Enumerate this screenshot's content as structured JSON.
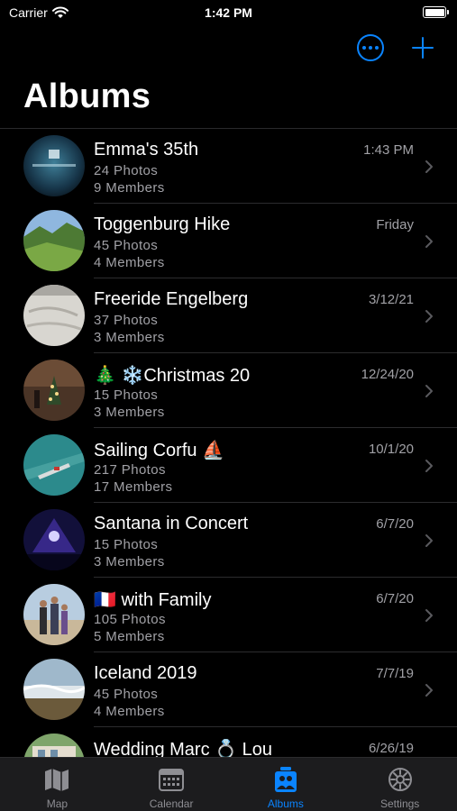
{
  "status_bar": {
    "carrier": "Carrier",
    "time": "1:42 PM"
  },
  "colors": {
    "accent": "#0a84ff",
    "background": "#000000",
    "secondary_text": "#a1a1a6",
    "tab_bar": "#1c1c1e"
  },
  "header": {
    "title": "Albums",
    "actions": [
      "more-icon",
      "plus-icon"
    ]
  },
  "albums": [
    {
      "title": "Emma's 35th",
      "photos": "24  Photos",
      "members": "9  Members",
      "date": "1:43 PM"
    },
    {
      "title": "Toggenburg Hike",
      "photos": "45  Photos",
      "members": "4  Members",
      "date": "Friday"
    },
    {
      "title": "Freeride Engelberg",
      "photos": "37  Photos",
      "members": "3  Members",
      "date": "3/12/21"
    },
    {
      "title": "🎄 ❄️Christmas 20",
      "photos": "15  Photos",
      "members": "3  Members",
      "date": "12/24/20"
    },
    {
      "title": "Sailing Corfu ⛵",
      "photos": "217  Photos",
      "members": "17  Members",
      "date": "10/1/20"
    },
    {
      "title": "Santana in Concert",
      "photos": "15  Photos",
      "members": "3  Members",
      "date": "6/7/20"
    },
    {
      "title": "🇫🇷 with Family",
      "photos": "105  Photos",
      "members": "5  Members",
      "date": "6/7/20"
    },
    {
      "title": "Iceland 2019",
      "photos": "45  Photos",
      "members": "4  Members",
      "date": "7/7/19"
    },
    {
      "title": "Wedding Marc 💍 Lou",
      "photos": "",
      "members": "",
      "date": "6/26/19"
    }
  ],
  "tab_bar": {
    "tabs": [
      {
        "label": "Map",
        "icon": "map-icon",
        "active": false
      },
      {
        "label": "Calendar",
        "icon": "calendar-icon",
        "active": false
      },
      {
        "label": "Albums",
        "icon": "albums-icon",
        "active": true
      },
      {
        "label": "Settings",
        "icon": "gear-icon",
        "active": false
      }
    ]
  }
}
